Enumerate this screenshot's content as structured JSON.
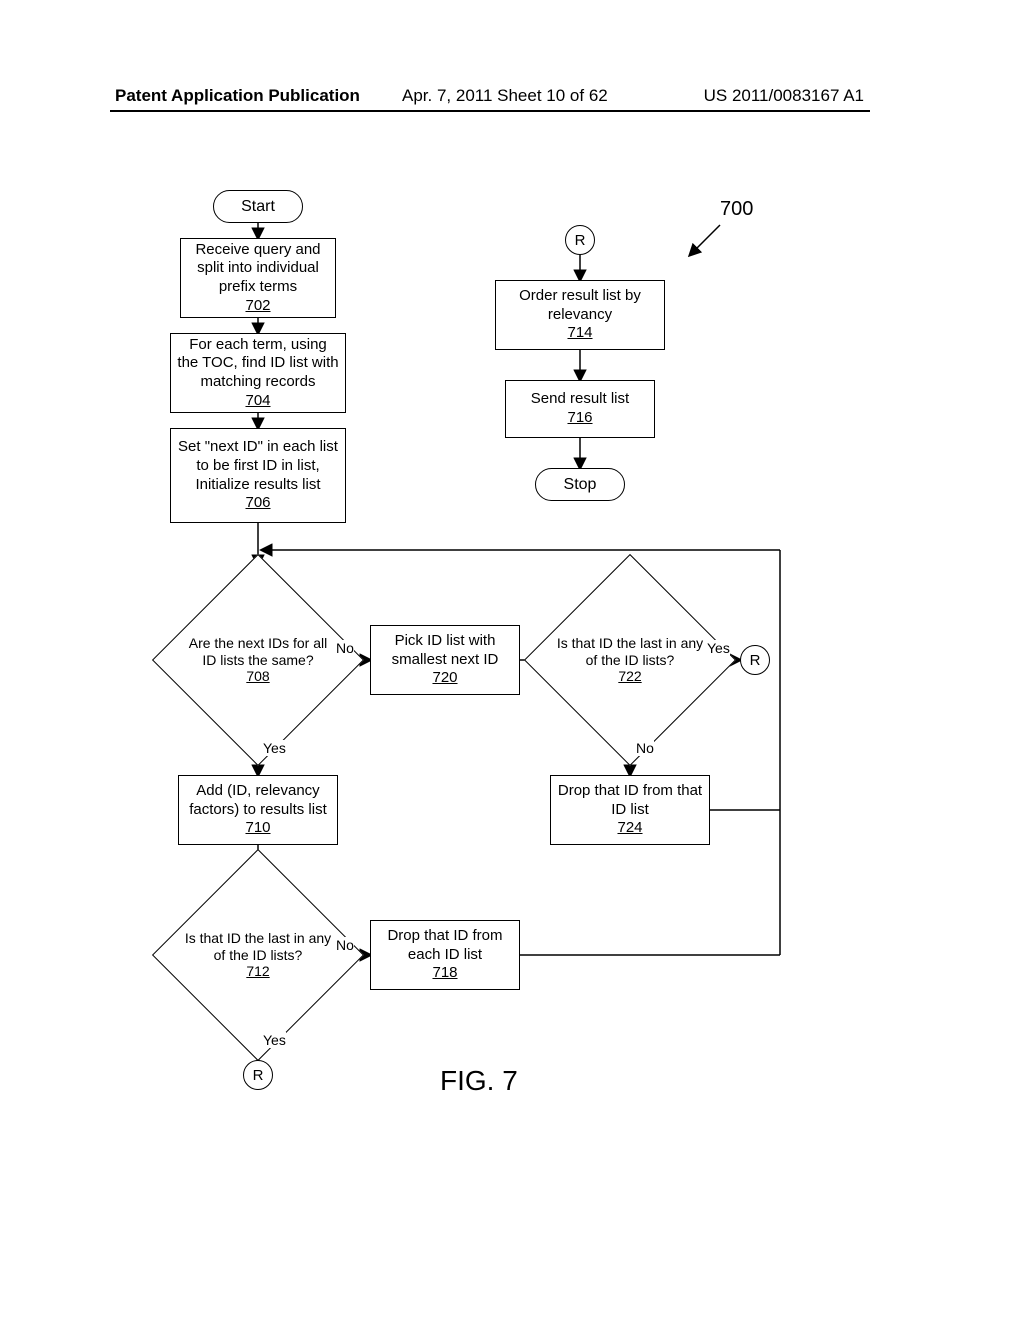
{
  "header": {
    "left": "Patent Application Publication",
    "center": "Apr. 7, 2011  Sheet 10 of 62",
    "right": "US 2011/0083167 A1"
  },
  "ref": "700",
  "figLabel": "FIG. 7",
  "connectors": {
    "r": "R"
  },
  "terminators": {
    "start": "Start",
    "stop": "Stop"
  },
  "labels": {
    "yes": "Yes",
    "no": "No"
  },
  "nodes": {
    "n702": {
      "text": "Receive query and split into individual prefix terms",
      "num": "702"
    },
    "n704": {
      "text": "For each term, using the TOC, find ID list with matching records",
      "num": "704"
    },
    "n706": {
      "text": "Set \"next ID\" in each list to be first ID in list, Initialize results list",
      "num": "706"
    },
    "n708": {
      "text": "Are the next IDs for all ID lists the same?",
      "num": "708"
    },
    "n710": {
      "text": "Add (ID, relevancy factors) to results list",
      "num": "710"
    },
    "n712": {
      "text": "Is that ID the last in any of the ID lists?",
      "num": "712"
    },
    "n714": {
      "text": "Order result list by relevancy",
      "num": "714"
    },
    "n716": {
      "text": "Send result list",
      "num": "716"
    },
    "n718": {
      "text": "Drop that ID from each ID list",
      "num": "718"
    },
    "n720": {
      "text": "Pick ID list with smallest next ID",
      "num": "720"
    },
    "n722": {
      "text": "Is that ID the last in any of the ID lists?",
      "num": "722"
    },
    "n724": {
      "text": "Drop that ID from that ID list",
      "num": "724"
    }
  }
}
